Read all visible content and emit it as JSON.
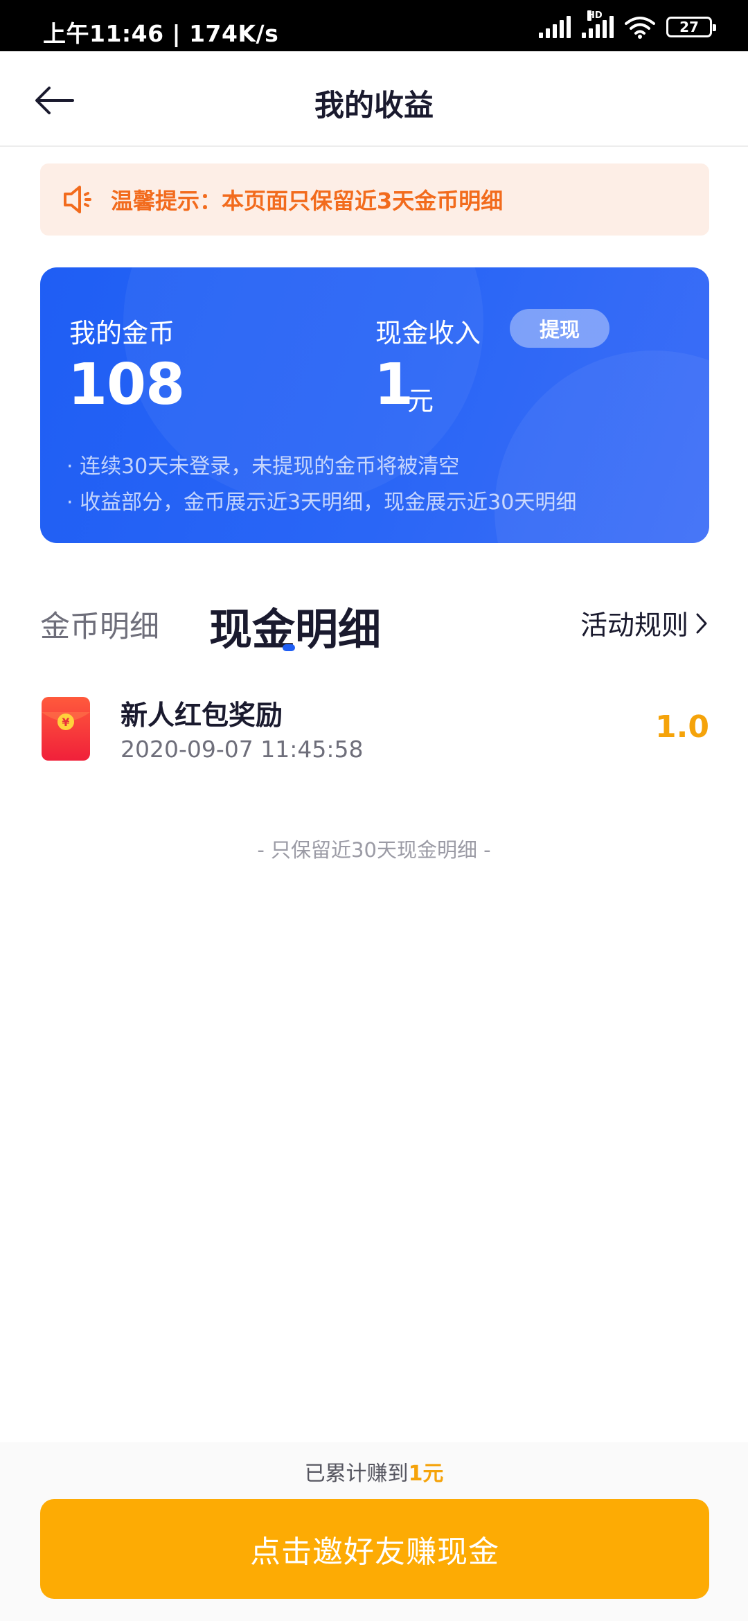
{
  "status_bar": {
    "time_and_speed": "上午11:46 | 174K/s",
    "signal_secondary_label": "HD",
    "battery_level": "27"
  },
  "header": {
    "title": "我的收益",
    "back_icon": "arrow-left-icon"
  },
  "notice": {
    "icon": "speaker-icon",
    "text": "温馨提示：本页面只保留近3天金币明细",
    "text_color": "#f26b1d",
    "background_color": "#fdeee6"
  },
  "summary_card": {
    "coin_label": "我的金币",
    "coin_value": "108",
    "cash_label": "现金收入",
    "withdraw_label": "提现",
    "cash_value": "1",
    "cash_unit": "元",
    "notes": [
      "· 连续30天未登录，未提现的金币将被清空",
      "· 收益部分，金币展示近3天明细，现金展示近30天明细"
    ],
    "accent_color": "#1f5ef4"
  },
  "tabs": {
    "items": [
      {
        "label": "金币明细",
        "active": false
      },
      {
        "label": "现金明细",
        "active": true
      }
    ],
    "rules_label": "活动规则",
    "rules_icon": "chevron-right-icon"
  },
  "records": [
    {
      "icon": "red-packet-icon",
      "title": "新人红包奖励",
      "time": "2020-09-07 11:45:58",
      "amount": "1.0"
    }
  ],
  "retain_note": "- 只保留近30天现金明细 -",
  "footer": {
    "earned_prefix": "已累计赚到",
    "earned_amount": "1元",
    "invite_button_label": "点击邀好友赚现金",
    "button_color": "#fdab04"
  }
}
